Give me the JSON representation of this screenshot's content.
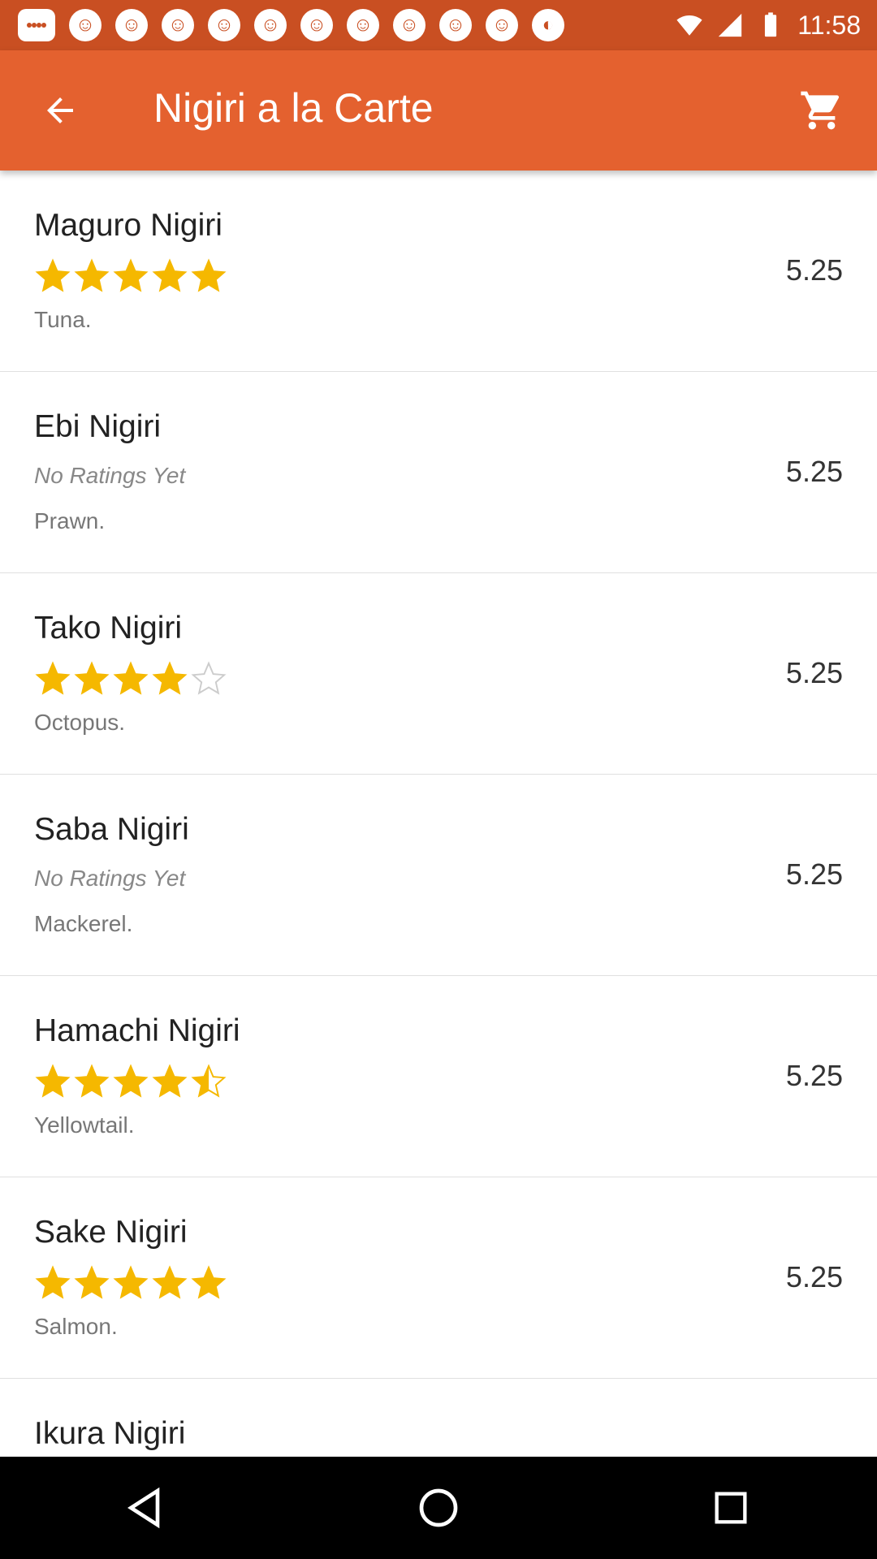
{
  "status_bar": {
    "time": "11:58",
    "notification_icons": [
      "message-icon",
      "app-notification-icon",
      "app-notification-icon",
      "app-notification-icon",
      "app-notification-icon",
      "app-notification-icon",
      "app-notification-icon",
      "app-notification-icon",
      "app-notification-icon",
      "app-notification-icon",
      "app-notification-icon",
      "circular-sync-icon"
    ],
    "right_icons": [
      "wifi-icon",
      "signal-icon",
      "battery-icon"
    ]
  },
  "app_bar": {
    "title": "Nigiri a la Carte",
    "back_icon": "arrow-back-icon",
    "cart_icon": "shopping-cart-icon"
  },
  "colors": {
    "status_bar": "#c94f22",
    "app_bar": "#e4612f",
    "star_filled": "#f5b800",
    "star_empty": "#cccccc"
  },
  "menu": {
    "items": [
      {
        "name": "Maguro Nigiri",
        "rating": 5,
        "rating_text": "",
        "description": "Tuna.",
        "price": "5.25"
      },
      {
        "name": "Ebi Nigiri",
        "rating": null,
        "rating_text": "No Ratings Yet",
        "description": "Prawn.",
        "price": "5.25"
      },
      {
        "name": "Tako Nigiri",
        "rating": 4,
        "rating_text": "",
        "description": "Octopus.",
        "price": "5.25"
      },
      {
        "name": "Saba Nigiri",
        "rating": null,
        "rating_text": "No Ratings Yet",
        "description": "Mackerel.",
        "price": "5.25"
      },
      {
        "name": "Hamachi Nigiri",
        "rating": 4.5,
        "rating_text": "",
        "description": "Yellowtail.",
        "price": "5.25"
      },
      {
        "name": "Sake Nigiri",
        "rating": 5,
        "rating_text": "",
        "description": "Salmon.",
        "price": "5.25"
      },
      {
        "name": "Ikura Nigiri",
        "rating": null,
        "rating_text": "",
        "description": "",
        "price": ""
      }
    ]
  },
  "nav_bar": {
    "icons": [
      "back-triangle-icon",
      "home-circle-icon",
      "recents-square-icon"
    ]
  }
}
